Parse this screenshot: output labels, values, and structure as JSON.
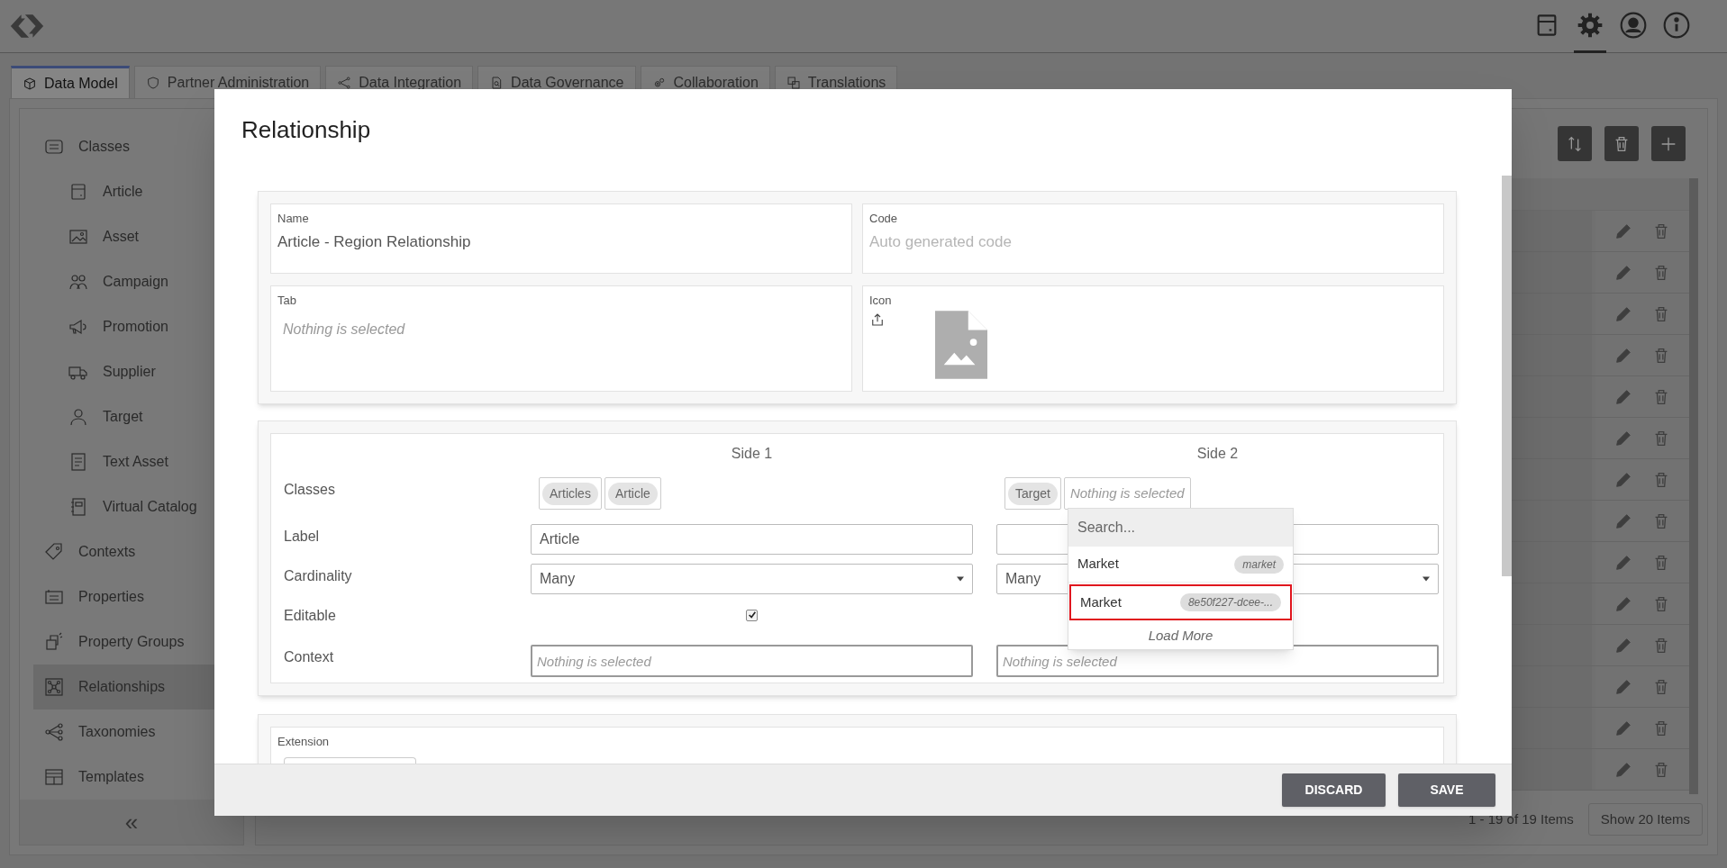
{
  "header": {
    "buttons": [
      {
        "selected": false
      },
      {
        "selected": true
      },
      {
        "selected": false
      },
      {
        "selected": false
      }
    ]
  },
  "tabs": [
    {
      "label": "Data Model",
      "selected": true
    },
    {
      "label": "Partner Administration",
      "selected": false
    },
    {
      "label": "Data Integration",
      "selected": false
    },
    {
      "label": "Data Governance",
      "selected": false
    },
    {
      "label": "Collaboration",
      "selected": false
    },
    {
      "label": "Translations",
      "selected": false
    }
  ],
  "sidebar": {
    "items": [
      {
        "label": "Classes",
        "selected": false,
        "children": [
          {
            "label": "Article",
            "selected": false
          },
          {
            "label": "Asset",
            "selected": false
          },
          {
            "label": "Campaign",
            "selected": false
          },
          {
            "label": "Promotion",
            "selected": false
          },
          {
            "label": "Supplier",
            "selected": false
          },
          {
            "label": "Target",
            "selected": false
          },
          {
            "label": "Text Asset",
            "selected": false
          },
          {
            "label": "Virtual Catalog",
            "selected": false
          }
        ]
      },
      {
        "label": "Contexts",
        "selected": false
      },
      {
        "label": "Properties",
        "selected": false
      },
      {
        "label": "Property Groups",
        "selected": false
      },
      {
        "label": "Relationships",
        "selected": true
      },
      {
        "label": "Taxonomies",
        "selected": false
      },
      {
        "label": "Templates",
        "selected": false
      }
    ],
    "collapse": "«"
  },
  "pagination": {
    "summary": "1 - 19 of 19 Items",
    "page_size_button": "Show 20 Items"
  },
  "dialog": {
    "title": "Relationship",
    "general": {
      "name": {
        "label": "Name",
        "value": "Article - Region Relationship"
      },
      "code": {
        "label": "Code",
        "placeholder": "Auto generated code"
      },
      "tab": {
        "label": "Tab",
        "placeholder": "Nothing is selected"
      },
      "icon": {
        "label": "Icon"
      }
    },
    "relation": {
      "side_headers": [
        "Side 1",
        "Side 2"
      ],
      "row_labels": [
        "Classes",
        "Label",
        "Cardinality",
        "Editable",
        "Context"
      ],
      "sides": [
        {
          "classes": [
            "Articles",
            "Article"
          ],
          "label_value": "Article",
          "cardinality": "Many",
          "editable": true,
          "context_placeholder": "Nothing is selected"
        },
        {
          "classes": [
            "Target"
          ],
          "classes_placeholder": "Nothing is selected",
          "cardinality": "Many",
          "context_placeholder": "Nothing is selected"
        }
      ]
    },
    "dropdown": {
      "search_placeholder": "Search...",
      "options": [
        {
          "label": "Market",
          "tag": "market",
          "selected": false
        },
        {
          "label": "Market",
          "tag": "8e50f227-dcee-...",
          "selected": true
        }
      ],
      "load_more": "Load More"
    },
    "extension": {
      "label": "Extension"
    },
    "buttons": [
      {
        "label": "DISCARD"
      },
      {
        "label": "SAVE"
      }
    ]
  }
}
